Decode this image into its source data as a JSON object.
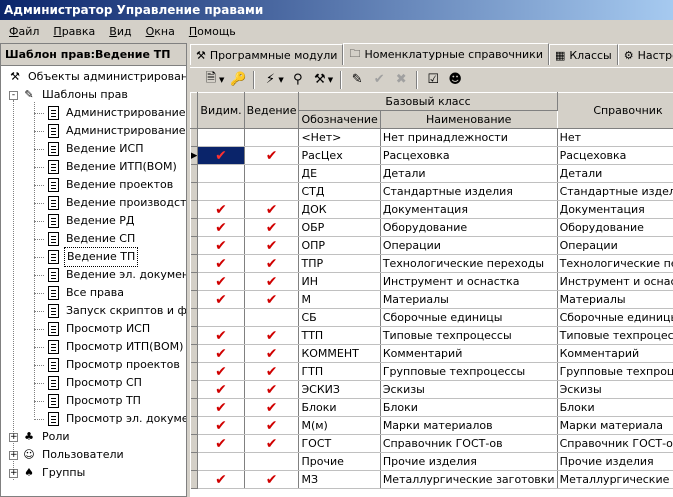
{
  "window": {
    "title": "Администратор Управление правами"
  },
  "menu": [
    "Файл",
    "Правка",
    "Вид",
    "Окна",
    "Помощь"
  ],
  "left": {
    "header": "Шаблон прав:Ведение ТП",
    "root": "Объекты администрирования",
    "templates_label": "Шаблоны прав",
    "templates": [
      "Администрирование С",
      "Администрирование Т",
      "Ведение ИСП",
      "Ведение ИТП(ВОМ)",
      "Ведение проектов",
      "Ведение производств",
      "Ведение РД",
      "Ведение СП",
      "Ведение ТП",
      "Ведение эл. документ",
      "Все права",
      "Запуск скриптов и фо",
      "Просмотр ИСП",
      "Просмотр ИТП(ВОМ)",
      "Просмотр проектов",
      "Просмотр СП",
      "Просмотр ТП",
      "Просмотр эл. докумен"
    ],
    "selected": "Ведение ТП",
    "others": [
      "Роли",
      "Пользователи",
      "Группы"
    ]
  },
  "tabs": [
    "Программные модули",
    "Номенклатурные справочники",
    "Классы",
    "Настрой"
  ],
  "active_tab": "Номенклатурные справочники",
  "table": {
    "headers": {
      "visible": "Видим.",
      "maintain": "Ведение",
      "base_class": "Базовый класс",
      "code": "Обозначение",
      "name": "Наименование",
      "ref": "Справочник"
    },
    "rows": [
      {
        "v": false,
        "m": false,
        "code": "<Нет>",
        "name": "Нет принадлежности",
        "ref": "Нет"
      },
      {
        "v": true,
        "m": true,
        "code": "РасЦех",
        "name": "Расцеховка",
        "ref": "Расцеховка",
        "current": true
      },
      {
        "v": false,
        "m": false,
        "code": "ДЕ",
        "name": "Детали",
        "ref": "Детали"
      },
      {
        "v": false,
        "m": false,
        "code": "СТД",
        "name": "Стандартные изделия",
        "ref": "Стандартные изделия"
      },
      {
        "v": true,
        "m": true,
        "code": "ДОК",
        "name": "Документация",
        "ref": "Документация"
      },
      {
        "v": true,
        "m": true,
        "code": "ОБР",
        "name": "Оборудование",
        "ref": "Оборудование"
      },
      {
        "v": true,
        "m": true,
        "code": "ОПР",
        "name": "Операции",
        "ref": "Операции"
      },
      {
        "v": true,
        "m": true,
        "code": "ТПР",
        "name": "Технологические переходы",
        "ref": "Технологические пер"
      },
      {
        "v": true,
        "m": true,
        "code": "ИН",
        "name": "Инструмент и оснастка",
        "ref": "Инструмент и оснастка"
      },
      {
        "v": true,
        "m": true,
        "code": "М",
        "name": "Материалы",
        "ref": "Материалы"
      },
      {
        "v": false,
        "m": false,
        "code": "СБ",
        "name": "Сборочные единицы",
        "ref": "Сборочные единицы"
      },
      {
        "v": true,
        "m": true,
        "code": "ТТП",
        "name": "Типовые техпроцессы",
        "ref": "Типовые техпроцессы"
      },
      {
        "v": true,
        "m": true,
        "code": "КОММЕНТ",
        "name": "Комментарий",
        "ref": "Комментарий"
      },
      {
        "v": true,
        "m": true,
        "code": "ГТП",
        "name": "Групповые техпроцессы",
        "ref": "Групповые техпроцес"
      },
      {
        "v": true,
        "m": true,
        "code": "ЭСКИЗ",
        "name": "Эскизы",
        "ref": "Эскизы"
      },
      {
        "v": true,
        "m": true,
        "code": "Блоки",
        "name": "Блоки",
        "ref": "Блоки"
      },
      {
        "v": true,
        "m": true,
        "code": "М(м)",
        "name": "Марки материалов",
        "ref": "Марки материала"
      },
      {
        "v": true,
        "m": true,
        "code": "ГОСТ",
        "name": "Справочник ГОСТ-ов",
        "ref": "Справочник ГОСТ-ов"
      },
      {
        "v": false,
        "m": false,
        "code": "Прочие",
        "name": "Прочие изделия",
        "ref": "Прочие изделия"
      },
      {
        "v": true,
        "m": true,
        "code": "МЗ",
        "name": "Металлургические заготовки",
        "ref": "Металлургические за"
      }
    ]
  },
  "check_mark": "✔"
}
